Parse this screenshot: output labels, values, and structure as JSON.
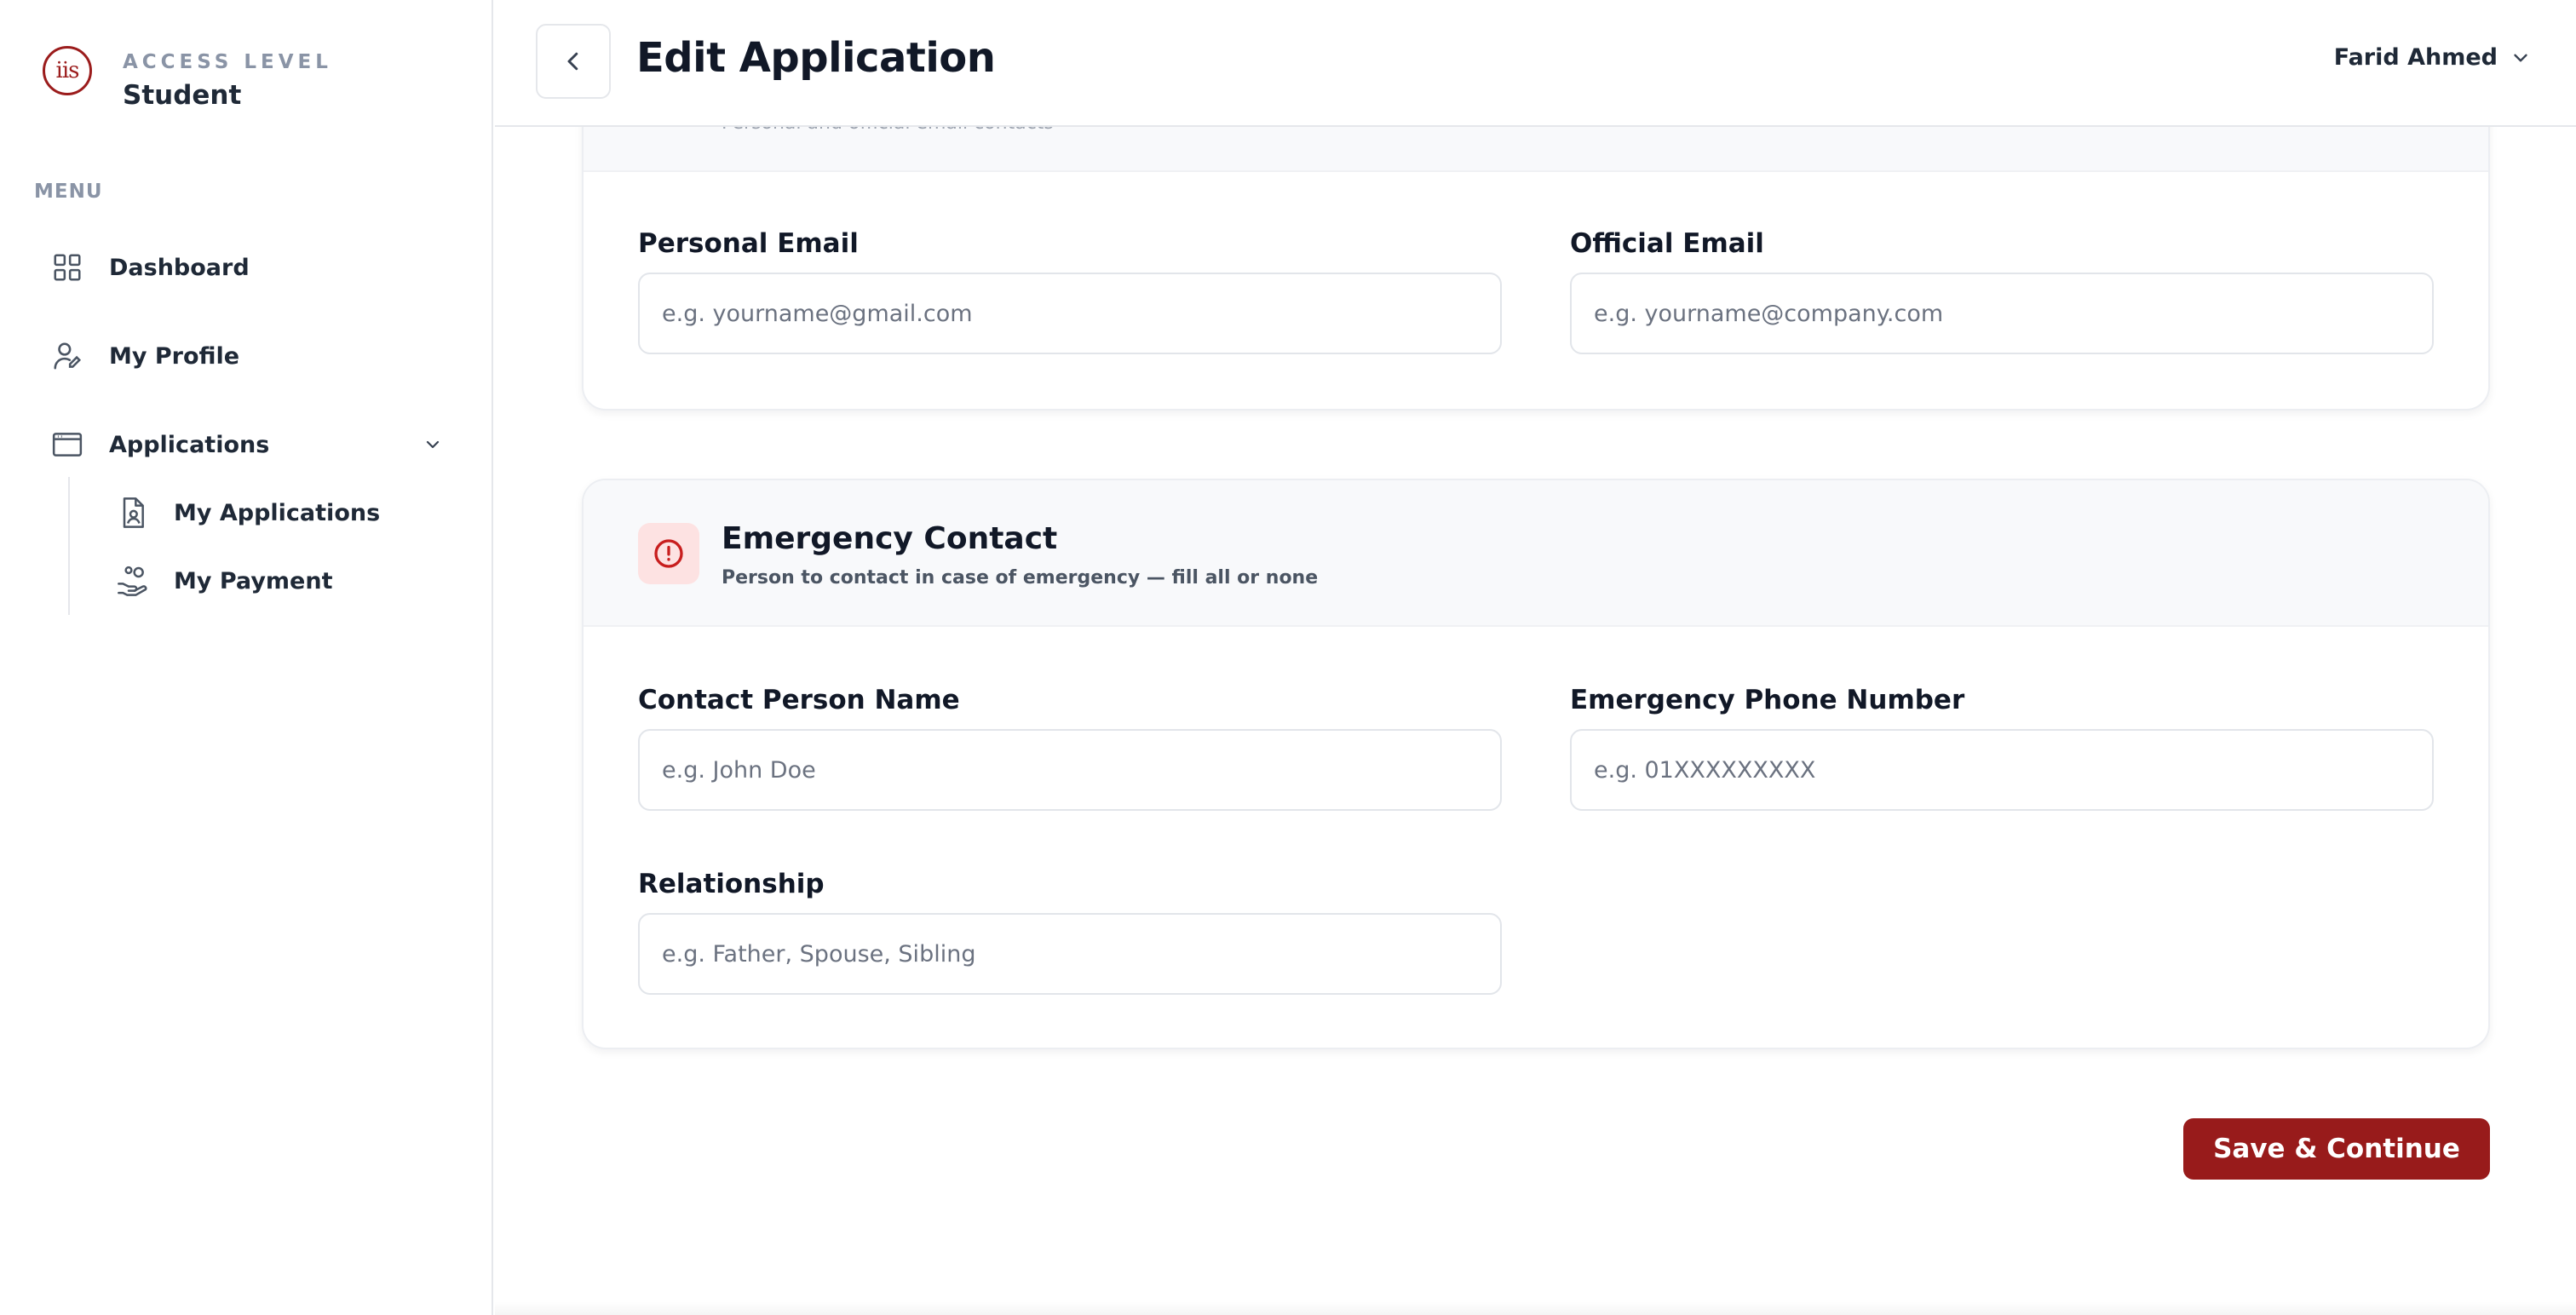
{
  "sidebar": {
    "brand_logo_text": "iis",
    "access_label": "ACCESS LEVEL",
    "access_role": "Student",
    "menu_heading": "MENU",
    "items": [
      {
        "label": "Dashboard",
        "icon": "grid-icon"
      },
      {
        "label": "My Profile",
        "icon": "user-edit-icon"
      },
      {
        "label": "Applications",
        "icon": "window-icon",
        "expanded": true
      }
    ],
    "sub_items": [
      {
        "label": "My Applications",
        "icon": "file-user-icon"
      },
      {
        "label": "My Payment",
        "icon": "hand-coins-icon"
      }
    ]
  },
  "header": {
    "title": "Edit Application",
    "user_name": "Farid Ahmed"
  },
  "email_section": {
    "subtitle": "Personal and official email contacts",
    "personal_email": {
      "label": "Personal Email",
      "placeholder": "e.g. yourname@gmail.com",
      "value": ""
    },
    "official_email": {
      "label": "Official Email",
      "placeholder": "e.g. yourname@company.com",
      "value": ""
    }
  },
  "emergency_section": {
    "title": "Emergency Contact",
    "subtitle": "Person to contact in case of emergency — fill all or none",
    "contact_name": {
      "label": "Contact Person Name",
      "placeholder": "e.g. John Doe",
      "value": ""
    },
    "phone": {
      "label": "Emergency Phone Number",
      "placeholder": "e.g. 01XXXXXXXXX",
      "value": ""
    },
    "relationship": {
      "label": "Relationship",
      "placeholder": "e.g. Father, Spouse, Sibling",
      "value": ""
    }
  },
  "actions": {
    "save_label": "Save & Continue"
  },
  "colors": {
    "brand": "#9b1c1c",
    "primary_button": "#981b1b",
    "alert_bg": "#fde2e2",
    "alert_icon": "#c81e1e"
  }
}
